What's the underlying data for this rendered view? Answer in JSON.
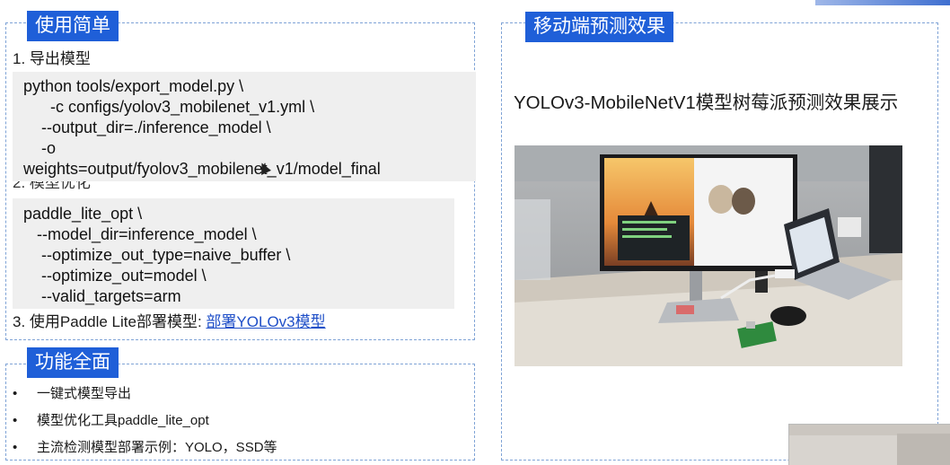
{
  "sections": {
    "simple": {
      "tag": "使用简单",
      "step1": "1.   导出模型",
      "export_code": "python tools/export_model.py \\\n      -c configs/yolov3_mobilenet_v1.yml \\\n    --output_dir=./inference_model \\\n    -o\nweights=output/fyolov3_mobilenet_v1/model_final",
      "step2": "2.   模型优化",
      "opt_code": "paddle_lite_opt \\\n   --model_dir=inference_model \\\n    --optimize_out_type=naive_buffer \\\n    --optimize_out=model \\\n    --valid_targets=arm",
      "step3_prefix": "3. 使用Paddle Lite部署模型: ",
      "step3_link": "部署YOLOv3模型"
    },
    "features": {
      "tag": "功能全面",
      "bullet_char": "•",
      "items": [
        "一键式模型导出",
        "模型优化工具paddle_lite_opt",
        "主流检测模型部署示例：YOLO，SSD等"
      ]
    },
    "mobile": {
      "tag": "移动端预测效果",
      "caption": "YOLOv3-MobileNetV1模型树莓派预测效果展示"
    }
  },
  "colors": {
    "tag_bg": "#1f5fd8",
    "dashed_border": "#7fa3d6",
    "code_bg": "#efefef",
    "link": "#1f4fc8"
  },
  "icons": [
    "mouse-cursor-icon"
  ]
}
